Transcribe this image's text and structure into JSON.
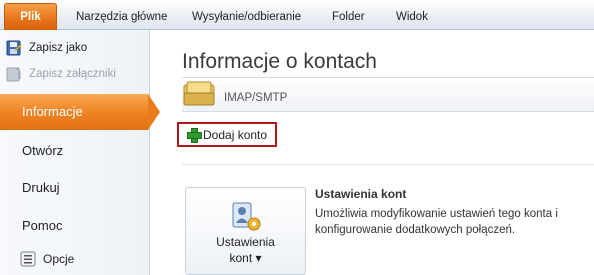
{
  "ribbon": {
    "tabs": [
      "Plik",
      "Narzędzia główne",
      "Wysyłanie/odbieranie",
      "Folder",
      "Widok"
    ]
  },
  "sidebar": {
    "save_as": "Zapisz jako",
    "save_attachments": "Zapisz załączniki",
    "nav": [
      "Informacje",
      "Otwórz",
      "Drukuj",
      "Pomoc"
    ],
    "options": "Opcje"
  },
  "main": {
    "title": "Informacje o kontach",
    "account_type": "IMAP/SMTP",
    "add_account": "Dodaj konto",
    "settings_button": {
      "line1": "Ustawienia",
      "line2": "kont ▾"
    },
    "section_title": "Ustawienia kont",
    "section_description": "Umożliwia modyfikowanie ustawień tego konta i konfigurowanie dodatkowych połączeń."
  },
  "colors": {
    "file_tab": "#e9761b",
    "selected_nav": "#ee8425",
    "highlight_border": "#b3141a"
  }
}
